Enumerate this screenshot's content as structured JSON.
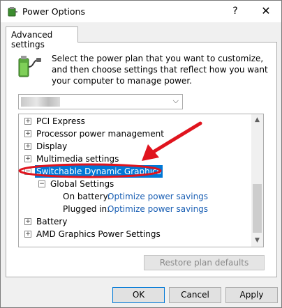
{
  "window": {
    "title": "Power Options",
    "help_label": "?",
    "close_label": "✕"
  },
  "tab": {
    "label": "Advanced settings"
  },
  "description": "Select the power plan that you want to customize, and then choose settings that reflect how you want your computer to manage power.",
  "plan_select": {
    "value": "",
    "chevron": "⌵"
  },
  "tree": {
    "items": [
      {
        "label": "PCI Express",
        "toggle": "+"
      },
      {
        "label": "Processor power management",
        "toggle": "+"
      },
      {
        "label": "Display",
        "toggle": "+"
      },
      {
        "label": "Multimedia settings",
        "toggle": "+"
      },
      {
        "label": "Switchable Dynamic Graphics",
        "toggle": "−"
      },
      {
        "label": "Global Settings",
        "toggle": "−"
      },
      {
        "label": "On battery:",
        "value": "Optimize power savings"
      },
      {
        "label": "Plugged in:",
        "value": "Optimize power savings"
      },
      {
        "label": "Battery",
        "toggle": "+"
      },
      {
        "label": "AMD Graphics Power Settings",
        "toggle": "+"
      }
    ]
  },
  "scroll": {
    "up": "▲",
    "down": "▼"
  },
  "restore_label": "Restore plan defaults",
  "buttons": {
    "ok": "OK",
    "cancel": "Cancel",
    "apply": "Apply"
  },
  "annotation_colors": {
    "highlight": "#e0141e",
    "selection": "#0078d7"
  }
}
